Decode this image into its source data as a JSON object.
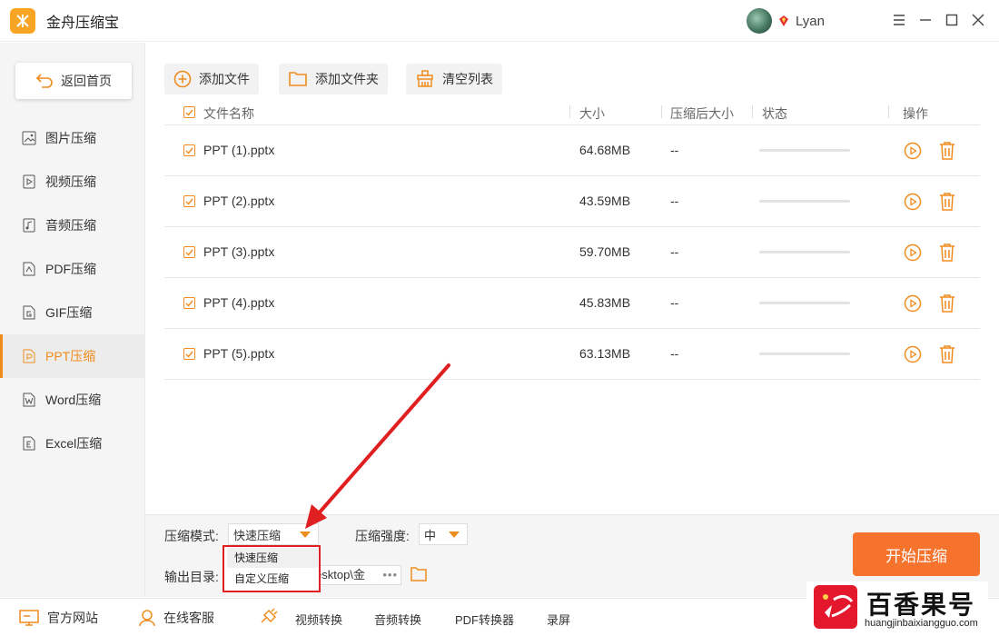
{
  "app": {
    "title": "金舟压缩宝",
    "username": "Lyan"
  },
  "sidebar": {
    "home_label": "返回首页",
    "items": [
      {
        "label": "图片压缩",
        "icon": "image-icon"
      },
      {
        "label": "视频压缩",
        "icon": "video-icon"
      },
      {
        "label": "音频压缩",
        "icon": "audio-icon"
      },
      {
        "label": "PDF压缩",
        "icon": "pdf-icon"
      },
      {
        "label": "GIF压缩",
        "icon": "gif-icon"
      },
      {
        "label": "PPT压缩",
        "icon": "ppt-icon",
        "active": true
      },
      {
        "label": "Word压缩",
        "icon": "word-icon"
      },
      {
        "label": "Excel压缩",
        "icon": "excel-icon"
      }
    ]
  },
  "toolbar": {
    "add_file": "添加文件",
    "add_folder": "添加文件夹",
    "clear_list": "清空列表"
  },
  "table": {
    "headers": {
      "name": "文件名称",
      "size": "大小",
      "compressed_size": "压缩后大小",
      "status": "状态",
      "actions": "操作"
    },
    "rows": [
      {
        "name": "PPT (1).pptx",
        "size": "64.68MB",
        "compressed": "--"
      },
      {
        "name": "PPT (2).pptx",
        "size": "43.59MB",
        "compressed": "--"
      },
      {
        "name": "PPT (3).pptx",
        "size": "59.70MB",
        "compressed": "--"
      },
      {
        "name": "PPT (4).pptx",
        "size": "45.83MB",
        "compressed": "--"
      },
      {
        "name": "PPT (5).pptx",
        "size": "63.13MB",
        "compressed": "--"
      }
    ]
  },
  "settings": {
    "mode_label": "压缩模式:",
    "mode_value": "快速压缩",
    "mode_options": [
      "快速压缩",
      "自定义压缩"
    ],
    "strength_label": "压缩强度:",
    "strength_value": "中",
    "output_label": "输出目录:",
    "output_path": "esktop\\金"
  },
  "start_button": "开始压缩",
  "footer": {
    "website": "官方网站",
    "support": "在线客服",
    "video_convert": "视频转换",
    "audio_convert": "音频转换",
    "pdf_convert": "PDF转换器",
    "record": "录屏"
  },
  "watermark": {
    "title": "百香果号",
    "url": "huangjinbaixiangguo.com"
  },
  "colors": {
    "accent": "#f08c1e",
    "start_button": "#f5732d",
    "annotation": "#e02020"
  }
}
